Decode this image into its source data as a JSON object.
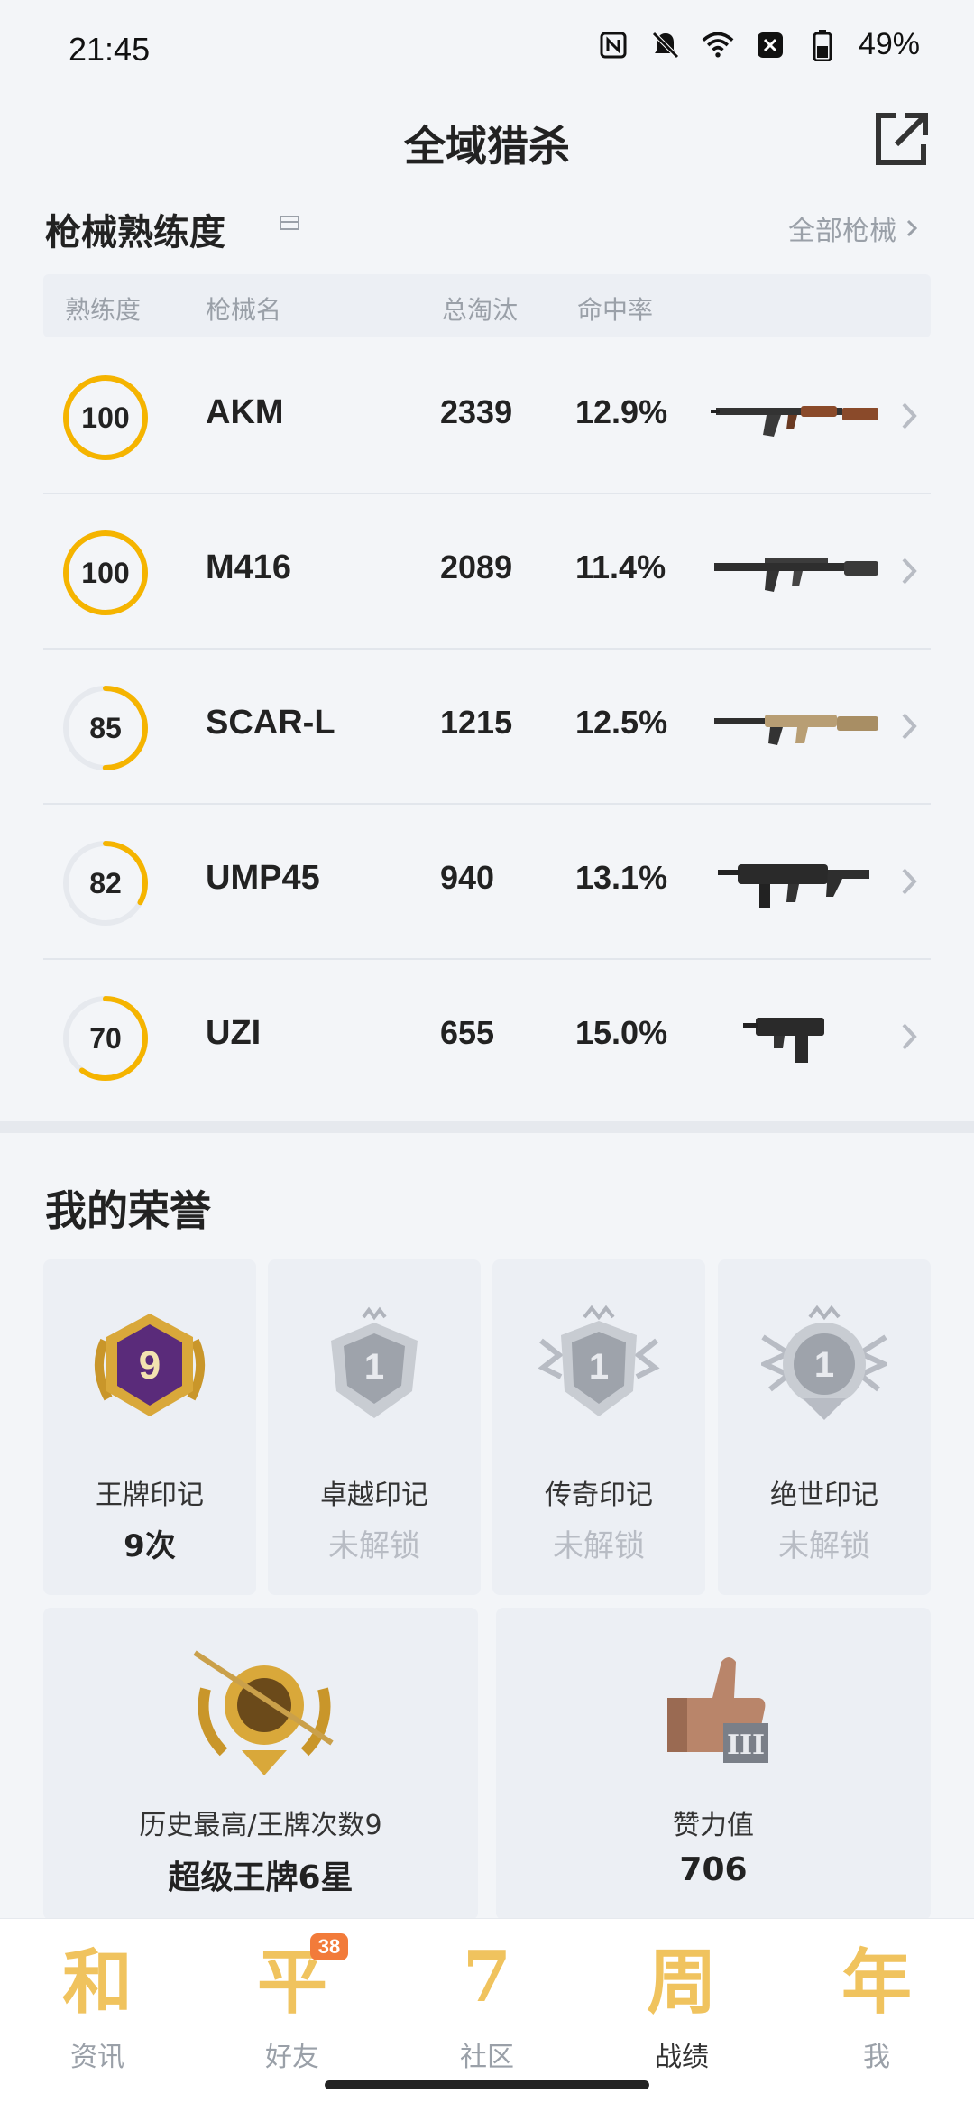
{
  "status_bar": {
    "time": "21:45",
    "icons": [
      "nfc-icon",
      "mute-icon",
      "wifi-icon",
      "close-box-icon",
      "battery-icon"
    ],
    "battery": "49%"
  },
  "header": {
    "title": "全域猎杀",
    "share_icon": "share-icon"
  },
  "weapons_section": {
    "title": "枪械熟练度",
    "all_link": "全部枪械",
    "columns": [
      "熟练度",
      "枪械名",
      "总淘汰",
      "命中率"
    ],
    "rows": [
      {
        "proficiency": "100",
        "name": "AKM",
        "kills": "2339",
        "hit_rate": "12.9%",
        "progress": 1.0
      },
      {
        "proficiency": "100",
        "name": "M416",
        "kills": "2089",
        "hit_rate": "11.4%",
        "progress": 1.0
      },
      {
        "proficiency": "85",
        "name": "SCAR-L",
        "kills": "1215",
        "hit_rate": "12.5%",
        "progress": 0.5
      },
      {
        "proficiency": "82",
        "name": "UMP45",
        "kills": "940",
        "hit_rate": "13.1%",
        "progress": 0.33
      },
      {
        "proficiency": "70",
        "name": "UZI",
        "kills": "655",
        "hit_rate": "15.0%",
        "progress": 0.6
      }
    ]
  },
  "honor_section": {
    "title": "我的荣誉",
    "cards": [
      {
        "name": "王牌印记",
        "value": "9次",
        "badge_text": "9",
        "locked": false
      },
      {
        "name": "卓越印记",
        "value": "未解锁",
        "badge_text": "1",
        "locked": true
      },
      {
        "name": "传奇印记",
        "value": "未解锁",
        "badge_text": "1",
        "locked": true
      },
      {
        "name": "绝世印记",
        "value": "未解锁",
        "badge_text": "1",
        "locked": true
      }
    ],
    "big_cards": [
      {
        "label": "历史最高/王牌次数9",
        "value": "超级王牌6星"
      },
      {
        "label": "赞力值",
        "value": "706"
      }
    ]
  },
  "colors": {
    "accent": "#f5b400",
    "ring_track": "#e6e9ee",
    "muted_text": "#9aa0a8",
    "badge_orange": "#f27b3a"
  },
  "bottom_nav": {
    "items": [
      {
        "glyph": "和",
        "label": "资讯",
        "active": false
      },
      {
        "glyph": "平",
        "label": "好友",
        "active": false,
        "badge": "38"
      },
      {
        "glyph": "7",
        "label": "社区",
        "active": false
      },
      {
        "glyph": "周",
        "label": "战绩",
        "active": true
      },
      {
        "glyph": "年",
        "label": "我",
        "active": false
      }
    ]
  }
}
